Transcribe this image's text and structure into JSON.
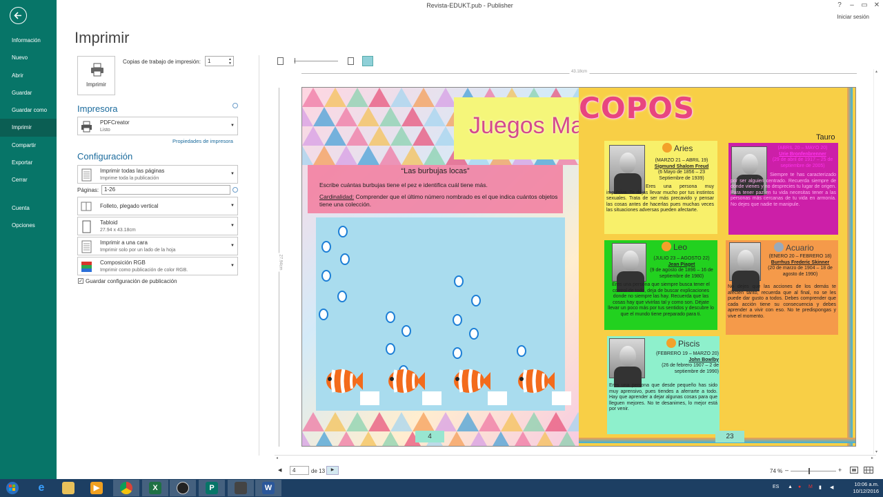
{
  "window": {
    "title": "Revista-EDUKT.pub - Publisher",
    "signin": "Iniciar sesión",
    "help": "?",
    "minimize": "–",
    "restore": "▭",
    "close": "✕"
  },
  "nav": {
    "items_top": [
      "Información",
      "Nuevo",
      "Abrir",
      "Guardar",
      "Guardar como",
      "Imprimir",
      "Compartir",
      "Exportar",
      "Cerrar"
    ],
    "items_bottom": [
      "Cuenta",
      "Opciones"
    ],
    "active": "Imprimir"
  },
  "print": {
    "title": "Imprimir",
    "button_label": "Imprimir",
    "copies_label": "Copias de trabajo de impresión:",
    "copies_value": "1",
    "printer_heading": "Impresora",
    "printer_name": "PDFCreator",
    "printer_status": "Listo",
    "printer_props_link": "Propiedades de impresora",
    "config_heading": "Configuración",
    "pages_option": {
      "l1": "Imprimir todas las páginas",
      "l2": "Imprime toda la publicación"
    },
    "pages_label": "Páginas:",
    "pages_value": "1-26",
    "layout_option": {
      "l1": "Folleto, plegado vertical"
    },
    "paper_option": {
      "l1": "Tabloid",
      "l2": "27.94 x 43.18cm"
    },
    "sides_option": {
      "l1": "Imprimir a una cara",
      "l2": "Imprimir solo por un lado de la hoja"
    },
    "color_option": {
      "l1": "Composición RGB",
      "l2": "Imprimir como publicación de color RGB."
    },
    "save_settings": "Guardar configuración de publicación",
    "check_mark": "✓"
  },
  "preview": {
    "ruler_width": "43.18cm",
    "ruler_height": "27.94cm",
    "left_page": {
      "title": "Juegos Ma",
      "activity_title": "“Las burbujas locas”",
      "instruction_1": "Escribe cuántas burbujas tiene el pez e identifica cuál tiene más.",
      "instruction_2_label": "Cardinalidad:",
      "instruction_2": " Comprender que el último número nombrado es el que indica cuántos objetos tiene una colección.",
      "page_number": "4",
      "bubble_columns": [
        6,
        4,
        5,
        1
      ]
    },
    "right_page": {
      "title": "COPOS",
      "tauro_label": "Tauro",
      "page_number": "23",
      "cards": [
        {
          "sign": "Aries",
          "dates": "(MARZO 21 – ABRIL 19)",
          "person": "Sigmund Shalom Freud",
          "life": "(6 Mayo de 1856 – 23 Septiembre de 1939)",
          "text": "Eres una persona muy impulsiva. Te dejas llevar mucho por tus instintos sexuales. Trata de ser más precavido y pensar las cosas antes de hacerlas pues muchas veces las situaciones adversas pueden afectarte.",
          "bg": "#f8f06a"
        },
        {
          "sign": "Tauro",
          "dates": "(ABRIL 20 – MAYO 20)",
          "person": "Urie Bronfenbrenner",
          "life": "(29 de abril de 1917 – 25 de septiembre de 2005)",
          "text": "Siempre te has caracterizado por ser alguien centrado. Recuerda siempre de dónde vienes y no desprecies tu lugar de origen. Para tener paz en tu vida necesitas tener a las personas más cercanas de tu vida en armonía. No dejes que nadie te manipule.",
          "bg": "#cc1fa8"
        },
        {
          "sign": "Leo",
          "dates": "(JULIO 23 – AGOSTO 22)",
          "person": "Jean Piaget",
          "life": "(9 de agosto de 1896 – 16 de septiembre de 1980)",
          "text": "Eres una persona que siempre busca tener el control de todo, deja de buscar explicaciones donde no siempre las hay. Recuerda que las cosas hay que vivirlas tal y como son. Déjate llevar un poco más por tus sentidos y descubre lo que el mundo tiene preparado para ti.",
          "bg": "#22d11f"
        },
        {
          "sign": "Acuario",
          "dates": "(ENERO 20 – FEBRERO 18)",
          "person": "Burrhus Frederic Skinner",
          "life": "(20 de marzo de 1904 – 18 de agosto de 1990)",
          "text": "No dejes que las acciones de los demás te afecten tanto, recuerda que al final, no se les puede dar gusto a todos. Debes comprender que cada acción tiene su consecuencia y debes aprender a vivir con eso. No te predispongas y vive el momento.",
          "bg": "#f59a4a"
        },
        {
          "sign": "Piscis",
          "dates": "(FEBRERO 19 – MARZO 20)",
          "person": "John Bowlby",
          "life": "(26 de febrero 1907 – 2 de septiembre de 1990)",
          "text": "Eres una persona que desde pequeño has sido muy aprensivo, pues tiendes a aferrarte a todo. Hay que aprender a dejar algunas cosas para que lleguen mejores. No te desanimes, lo mejor está por venir.",
          "bg": "#8ef0cc"
        }
      ]
    }
  },
  "status": {
    "page_value": "4",
    "page_of": "de 13",
    "zoom": "74 %",
    "zoom_minus": "–",
    "zoom_plus": "+"
  },
  "taskbar": {
    "lang": "ES",
    "time": "10:06 a.m.",
    "date": "10/12/2016",
    "apps": [
      "windows-start",
      "internet-explorer",
      "file-explorer",
      "media-player",
      "chrome",
      "excel",
      "obs",
      "publisher",
      "app-unknown",
      "word"
    ]
  }
}
